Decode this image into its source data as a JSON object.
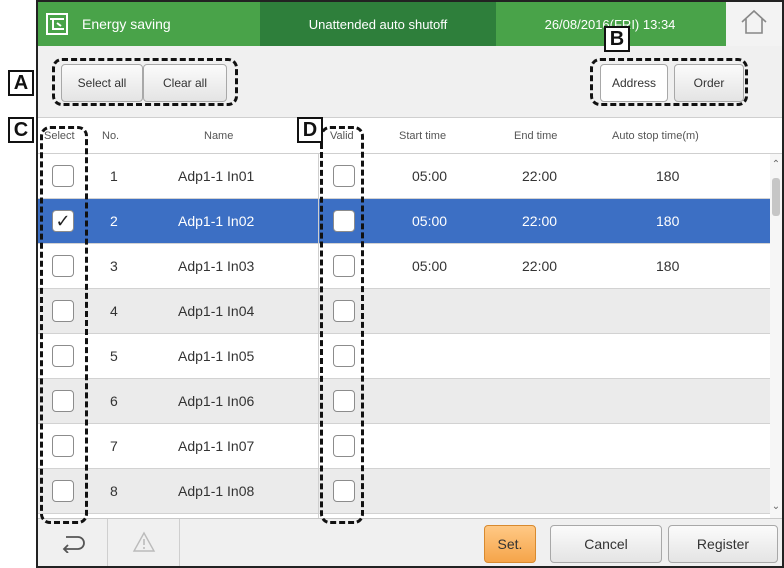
{
  "header": {
    "app_label": "Energy saving",
    "mode_label": "Unattended auto shutoff",
    "datetime": "26/08/2016(FRI) 13:34",
    "app_icon": "energy-saving-icon",
    "home_icon": "home-icon"
  },
  "toolbar": {
    "select_all": "Select all",
    "clear_all": "Clear all",
    "address": "Address",
    "order": "Order"
  },
  "columns": {
    "select": "Select",
    "no": "No.",
    "name": "Name",
    "valid": "Valid",
    "start": "Start time",
    "end": "End time",
    "auto_stop": "Auto stop time(m)"
  },
  "rows": [
    {
      "no": "1",
      "name": "Adp1-1 In01",
      "selected": false,
      "valid": false,
      "start": "05:00",
      "end": "22:00",
      "auto_stop": "180"
    },
    {
      "no": "2",
      "name": "Adp1-1 In02",
      "selected": true,
      "valid": false,
      "start": "05:00",
      "end": "22:00",
      "auto_stop": "180"
    },
    {
      "no": "3",
      "name": "Adp1-1 In03",
      "selected": false,
      "valid": false,
      "start": "05:00",
      "end": "22:00",
      "auto_stop": "180"
    },
    {
      "no": "4",
      "name": "Adp1-1 In04",
      "selected": false,
      "valid": false,
      "start": "",
      "end": "",
      "auto_stop": ""
    },
    {
      "no": "5",
      "name": "Adp1-1 In05",
      "selected": false,
      "valid": false,
      "start": "",
      "end": "",
      "auto_stop": ""
    },
    {
      "no": "6",
      "name": "Adp1-1 In06",
      "selected": false,
      "valid": false,
      "start": "",
      "end": "",
      "auto_stop": ""
    },
    {
      "no": "7",
      "name": "Adp1-1 In07",
      "selected": false,
      "valid": false,
      "start": "",
      "end": "",
      "auto_stop": ""
    },
    {
      "no": "8",
      "name": "Adp1-1 In08",
      "selected": false,
      "valid": false,
      "start": "",
      "end": "",
      "auto_stop": ""
    }
  ],
  "check_mark": "✓",
  "footer": {
    "set": "Set.",
    "cancel": "Cancel",
    "register": "Register",
    "back_icon": "back-icon",
    "warning_icon": "warning-icon"
  },
  "callouts": {
    "a": "A",
    "b": "B",
    "c": "C",
    "d": "D"
  },
  "colors": {
    "header_green": "#49a349",
    "mode_green": "#2e7f3b",
    "selected_row": "#3c6fc4",
    "set_button": "#f7b35c"
  }
}
